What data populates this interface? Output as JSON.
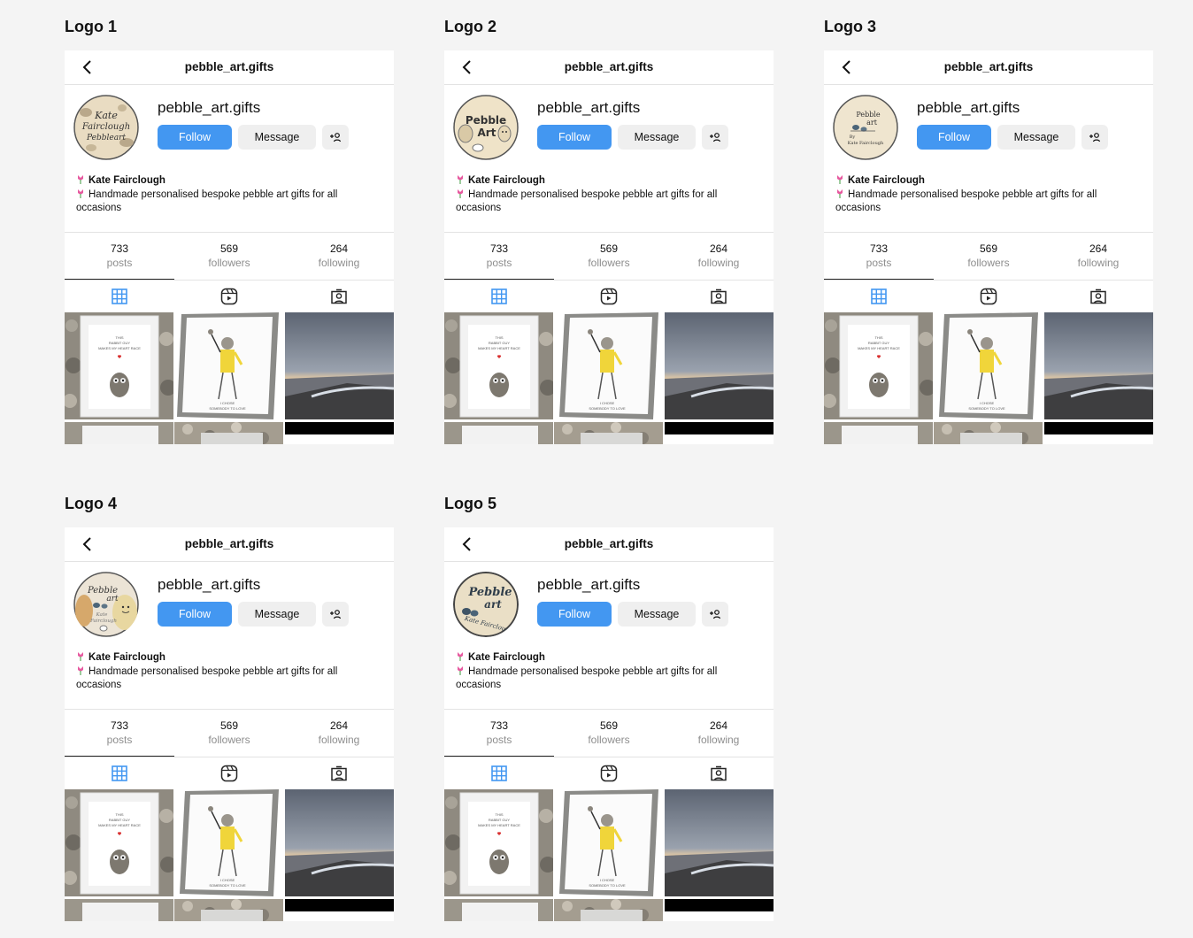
{
  "frames": [
    {
      "title": "Logo 1",
      "logo_text": [
        "Kate",
        "Fairclough",
        "Pebbleart"
      ]
    },
    {
      "title": "Logo 2",
      "logo_text": [
        "Pebble",
        "Art"
      ]
    },
    {
      "title": "Logo 3",
      "logo_text": [
        "Pebble",
        "art",
        "By",
        "Kate Fairclough"
      ]
    },
    {
      "title": "Logo 4",
      "logo_text": [
        "Pebble",
        "art",
        "Kate",
        "Fairclough"
      ]
    },
    {
      "title": "Logo 5",
      "logo_text": [
        "Pebble",
        "art",
        "Kate Fairclough"
      ]
    }
  ],
  "profile": {
    "handle": "pebble_art.gifts",
    "username": "pebble_art.gifts",
    "follow_label": "Follow",
    "message_label": "Message",
    "bio_name": "Kate Fairclough",
    "bio_text": "Handmade personalised bespoke pebble art gifts for all occasions",
    "stats": [
      {
        "value": "733",
        "label": "posts"
      },
      {
        "value": "569",
        "label": "followers"
      },
      {
        "value": "264",
        "label": "following"
      }
    ]
  },
  "icons": {
    "back": "back-chevron-icon",
    "add_user": "add-user-icon",
    "tabs": [
      "grid-icon",
      "reels-icon",
      "tagged-icon"
    ],
    "bio_bullet": "tulip-icon"
  },
  "colors": {
    "follow": "#4397f1",
    "secondary_button": "#efefef",
    "active_tab": "#4397f1",
    "inactive_tab": "#262626",
    "page_bg": "#f4f4f4"
  },
  "posts": [
    {
      "type": "framed-pebble-owl",
      "caption_lines": [
        "THIS",
        "RABBIT GUY",
        "MAKES MY HEART RACE"
      ]
    },
    {
      "type": "framed-pebble-figure",
      "caption_lines": [
        "I CHOSE",
        "SOMEBODY TO LOVE"
      ]
    },
    {
      "type": "beach-sunset"
    }
  ]
}
